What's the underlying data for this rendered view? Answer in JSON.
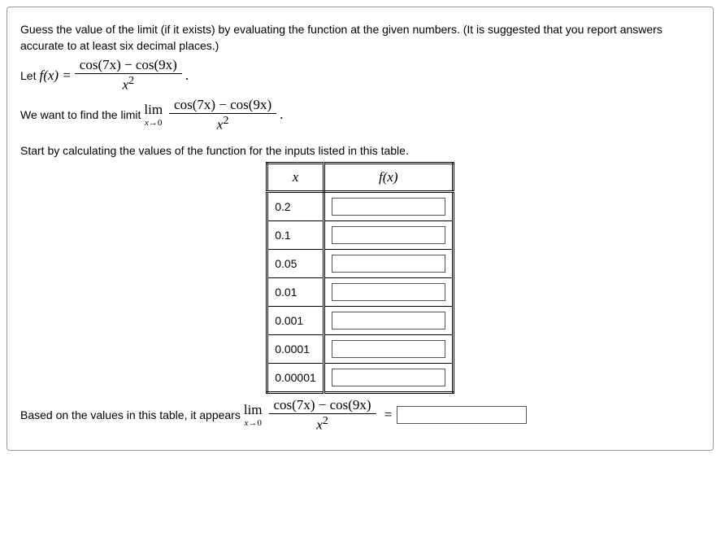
{
  "problem": {
    "intro1": "Guess the value of the limit (if it exists) by evaluating the function at the given numbers. (It is suggested that you report answers accurate to at least six decimal places.)",
    "let_label": "Let ",
    "fx_eq": "f(x) = ",
    "numerator": "cos(7x) − cos(9x)",
    "denominator_x2": "x",
    "exp2": "2",
    "period": ".",
    "want1": "We want to find the limit",
    "lim": "lim",
    "limsub_x": "x",
    "limsub_arrow": "→",
    "limsub_0": "0",
    "start_text": "Start by calculating the values of the function for the inputs listed in this table.",
    "table": {
      "header_x": "x",
      "header_fx": "f(x)",
      "rows": [
        "0.2",
        "0.1",
        "0.05",
        "0.01",
        "0.001",
        "0.0001",
        "0.00001"
      ]
    },
    "based_text": "Based on the values in this table, it appears",
    "equals": "="
  }
}
